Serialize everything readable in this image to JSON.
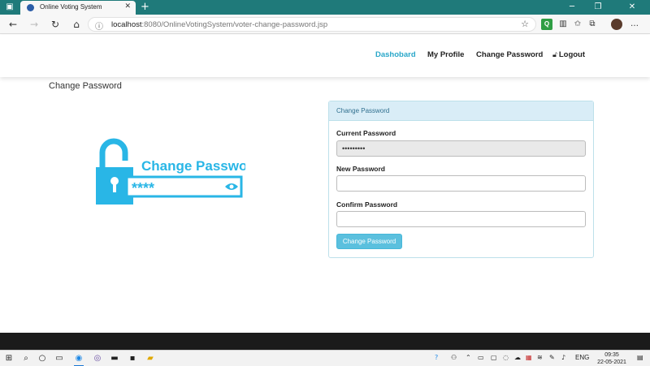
{
  "browser": {
    "tab_title": "Online Voting System",
    "url_host": "localhost",
    "url_rest": ":8080/OnlineVotingSystem/voter-change-password.jsp"
  },
  "navbar": {
    "items": [
      {
        "label": "Dashobard",
        "active": true
      },
      {
        "label": "My Profile",
        "active": false
      },
      {
        "label": "Change Password",
        "active": false
      },
      {
        "label": "Logout",
        "active": false
      }
    ]
  },
  "page": {
    "heading": "Change Password"
  },
  "illustration": {
    "title": "Change Password",
    "mask": "****"
  },
  "form": {
    "panel_title": "Change Password",
    "current_password_label": "Current Password",
    "current_password_value": "•••••••••",
    "new_password_label": "New Password",
    "new_password_value": "",
    "confirm_password_label": "Confirm Password",
    "confirm_password_value": "",
    "submit_label": "Change Password"
  },
  "taskbar": {
    "language": "ENG",
    "time": "09:35",
    "date": "22-05-2021"
  },
  "colors": {
    "accent": "#2aa7c9",
    "titlebar": "#1f7a7a",
    "panel_header": "#d9edf7",
    "button": "#5bc0de",
    "illustration": "#29b6e6"
  }
}
